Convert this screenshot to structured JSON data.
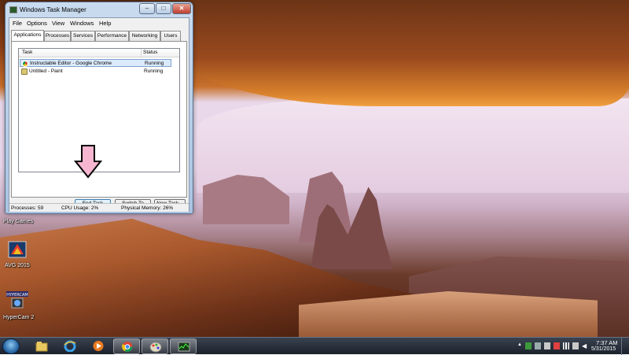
{
  "window": {
    "title": "Windows Task Manager",
    "controls": [
      "–",
      "□",
      "✕"
    ],
    "menu": [
      "File",
      "Options",
      "View",
      "Windows",
      "Help"
    ],
    "tabs": [
      "Applications",
      "Processes",
      "Services",
      "Performance",
      "Networking",
      "Users"
    ],
    "active_tab": "Applications",
    "columns": {
      "task": "Task",
      "status": "Status"
    },
    "tasks": [
      {
        "name": "Instructable Editor - Google Chrome",
        "status": "Running",
        "icon": "chrome-icon",
        "selected": true
      },
      {
        "name": "Untitled - Paint",
        "status": "Running",
        "icon": "paint-icon",
        "selected": false
      }
    ],
    "buttons": {
      "end_task": "End Task",
      "switch_to": "Switch To",
      "new_task": "New Task..."
    },
    "status": {
      "processes": "Processes: 59",
      "cpu": "CPU Usage: 2%",
      "memory": "Physical Memory: 26%"
    }
  },
  "desktop": {
    "labels": {
      "play_games": "Play Games",
      "avg": "AVG 2015",
      "hypercam": "HyperCam 2"
    },
    "hypercam_logo_text": "HYPERCAM"
  },
  "taskbar": {
    "pinned": [
      "windows-explorer-icon",
      "internet-explorer-icon",
      "media-player-icon",
      "chrome-icon",
      "paint-icon",
      "task-manager-icon"
    ],
    "time": "7:37 AM",
    "date": "5/31/2015"
  },
  "colors": {
    "arrow": "#f7b6d0",
    "selection": "#dcebfc",
    "taskbar": "#1c222c"
  }
}
